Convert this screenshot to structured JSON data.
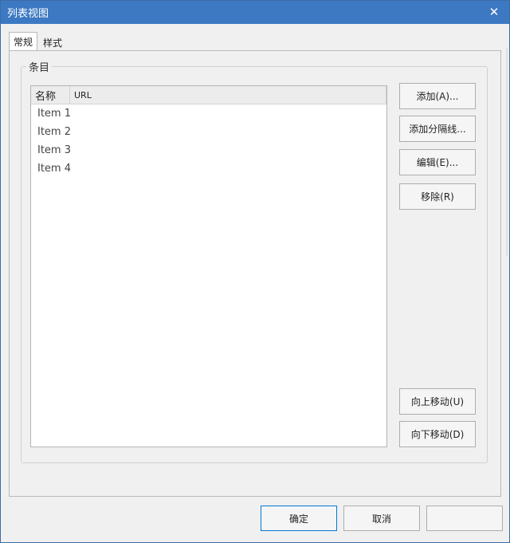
{
  "window": {
    "title": "列表视图",
    "close_glyph": "✕"
  },
  "tabs": [
    {
      "label": "常规",
      "active": true
    },
    {
      "label": "样式",
      "active": false
    }
  ],
  "group": {
    "legend": "条目"
  },
  "listview": {
    "columns": [
      "名称",
      "URL"
    ],
    "rows": [
      "Item 1",
      "Item 2",
      "Item 3",
      "Item 4"
    ]
  },
  "side_buttons": {
    "add": "添加(A)...",
    "add_separator": "添加分隔线...",
    "edit": "编辑(E)...",
    "remove": "移除(R)",
    "move_up": "向上移动(U)",
    "move_down": "向下移动(D)"
  },
  "footer": {
    "ok": "确定",
    "cancel": "取消"
  },
  "colors": {
    "titlebar": "#3d79c2",
    "primary_border": "#0078d7"
  },
  "icons": {
    "close": "close-icon"
  }
}
